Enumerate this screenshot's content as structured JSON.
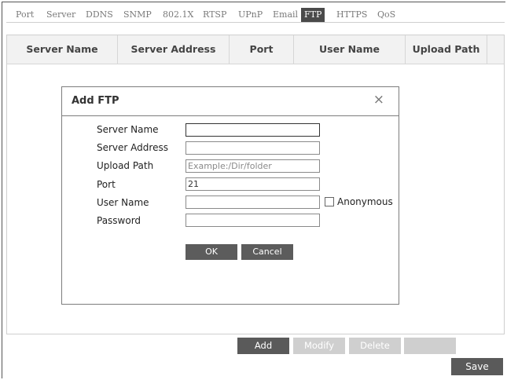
{
  "tabs": [
    {
      "label": "Port",
      "active": false
    },
    {
      "label": "Server",
      "active": false
    },
    {
      "label": "DDNS",
      "active": false
    },
    {
      "label": "SNMP",
      "active": false
    },
    {
      "label": "802.1X",
      "active": false
    },
    {
      "label": "RTSP",
      "active": false
    },
    {
      "label": "UPnP",
      "active": false
    },
    {
      "label": "Email",
      "active": false
    },
    {
      "label": "FTP",
      "active": true
    },
    {
      "label": "HTTPS",
      "active": false
    },
    {
      "label": "QoS",
      "active": false
    }
  ],
  "table": {
    "columns": [
      "Server Name",
      "Server Address",
      "Port",
      "User Name",
      "Upload Path"
    ]
  },
  "dialog": {
    "title": "Add FTP",
    "close_icon": "×",
    "fields": {
      "server_name": {
        "label": "Server Name",
        "value": ""
      },
      "server_address": {
        "label": "Server Address",
        "value": ""
      },
      "upload_path": {
        "label": "Upload Path",
        "value": "",
        "placeholder": "Example:/Dir/folder"
      },
      "port": {
        "label": "Port",
        "value": "21"
      },
      "user_name": {
        "label": "User Name",
        "value": ""
      },
      "password": {
        "label": "Password",
        "value": ""
      }
    },
    "anonymous_label": "Anonymous",
    "ok_label": "OK",
    "cancel_label": "Cancel"
  },
  "actions": {
    "add": "Add",
    "modify": "Modify",
    "delete": "Delete",
    "save": "Save"
  },
  "colors": {
    "active_tab_bg": "#4a4a4a",
    "button_dark": "#5a5a5a",
    "button_disabled": "#cfcfcf"
  }
}
